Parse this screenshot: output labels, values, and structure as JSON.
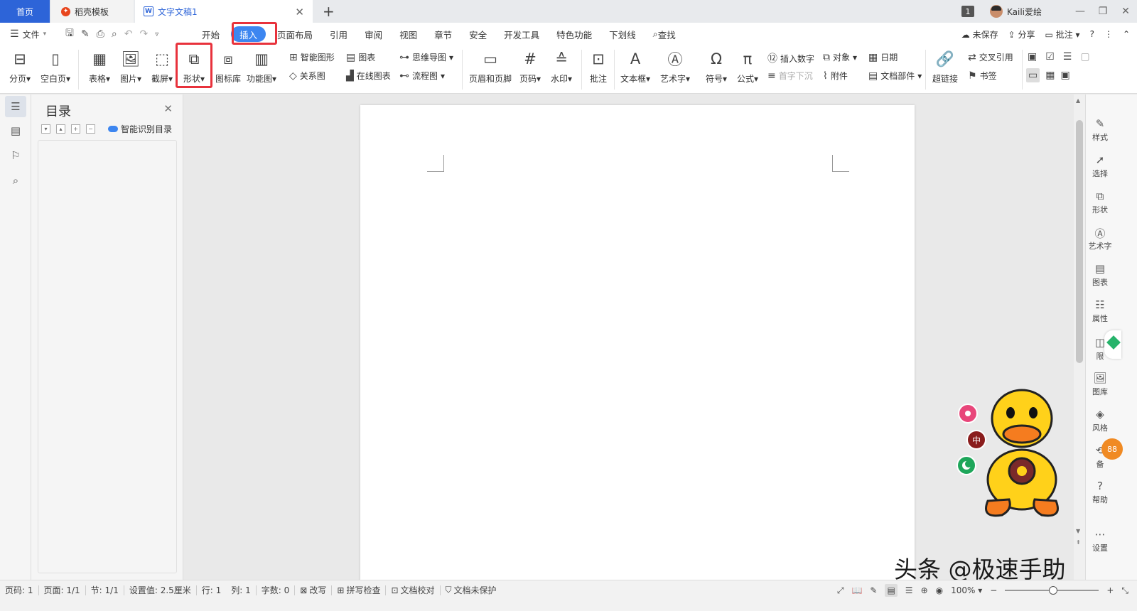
{
  "titlebar": {
    "tabs": {
      "home": "首页",
      "docer": "稻壳模板",
      "doc": "文字文稿1"
    },
    "window_count": "1",
    "user": "Kaili爱绘"
  },
  "menubar": {
    "file": "文件",
    "tabs": [
      "开始",
      "插入",
      "页面布局",
      "引用",
      "审阅",
      "视图",
      "章节",
      "安全",
      "开发工具",
      "特色功能",
      "下划线"
    ],
    "search": "查找",
    "unsaved": "未保存",
    "share": "分享",
    "comment": "批注"
  },
  "ribbon": {
    "page_break": "分页",
    "blank_page": "空白页",
    "table": "表格",
    "picture": "图片",
    "screenshot": "截屏",
    "shape": "形状",
    "icon_lib": "图标库",
    "func_chart": "功能图",
    "smart_graphic": "智能图形",
    "chart": "图表",
    "mind_map": "思维导图",
    "relation": "关系图",
    "online_chart": "在线图表",
    "flowchart": "流程图",
    "header_footer": "页眉和页脚",
    "page_number": "页码",
    "watermark": "水印",
    "comment": "批注",
    "textbox": "文本框",
    "wordart": "艺术字",
    "symbol": "符号",
    "formula": "公式",
    "insert_number": "插入数字",
    "object": "对象",
    "date": "日期",
    "drop_cap": "首字下沉",
    "attachment": "附件",
    "doc_parts": "文档部件",
    "hyperlink": "超链接",
    "cross_ref": "交叉引用",
    "bookmark": "书签"
  },
  "toc": {
    "title": "目录",
    "smart": "智能识别目录"
  },
  "rpanel": {
    "style": "样式",
    "select": "选择",
    "shape": "形状",
    "wordart": "艺术字",
    "chart": "图表",
    "property": "属性",
    "limit": "限",
    "gallery": "图库",
    "theme": "风格",
    "backup": "备",
    "help": "帮助",
    "settings": "设置",
    "badge": "88"
  },
  "status": {
    "page": "页码: 1",
    "pages": "页面: 1/1",
    "section": "节: 1/1",
    "setting": "设置值: 2.5厘米",
    "row": "行: 1",
    "col": "列: 1",
    "words": "字数: 0",
    "revise": "改写",
    "spell": "拼写检查",
    "proof": "文档校对",
    "protect": "文档未保护",
    "zoom": "100%"
  },
  "watermark_text": "头条 @极速手助",
  "colors": {
    "accent": "#2d64d8",
    "active_tab": "#3d86f0",
    "highlight": "#e8323c"
  }
}
